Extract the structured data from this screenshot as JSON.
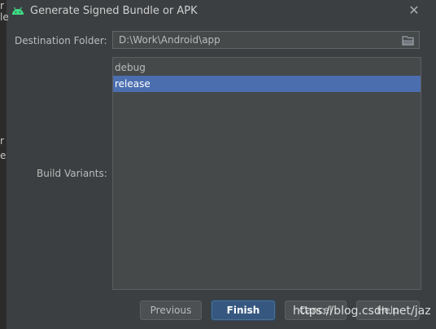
{
  "window": {
    "title": "Generate Signed Bundle or APK",
    "close_symbol": "✕",
    "app_icon": "android-icon"
  },
  "left_strip": {
    "fragments": [
      "r",
      "le",
      "r",
      "e"
    ]
  },
  "destination": {
    "label": "Destination Folder:",
    "value": "D:\\Work\\Android\\app",
    "browse_icon": "folder-icon"
  },
  "build_variants": {
    "label": "Build Variants:",
    "items": [
      {
        "label": "debug",
        "selected": false
      },
      {
        "label": "release",
        "selected": true
      }
    ]
  },
  "buttons": {
    "previous": "Previous",
    "finish": "Finish",
    "cancel": "Cancel",
    "help": "Help"
  },
  "watermark": {
    "text": "https://blog.csdn.net/jaz"
  },
  "colors": {
    "dialog_bg": "#3c3f41",
    "selection": "#4b6eaf",
    "primary_button": "#365880",
    "android_green": "#3ddc84"
  }
}
